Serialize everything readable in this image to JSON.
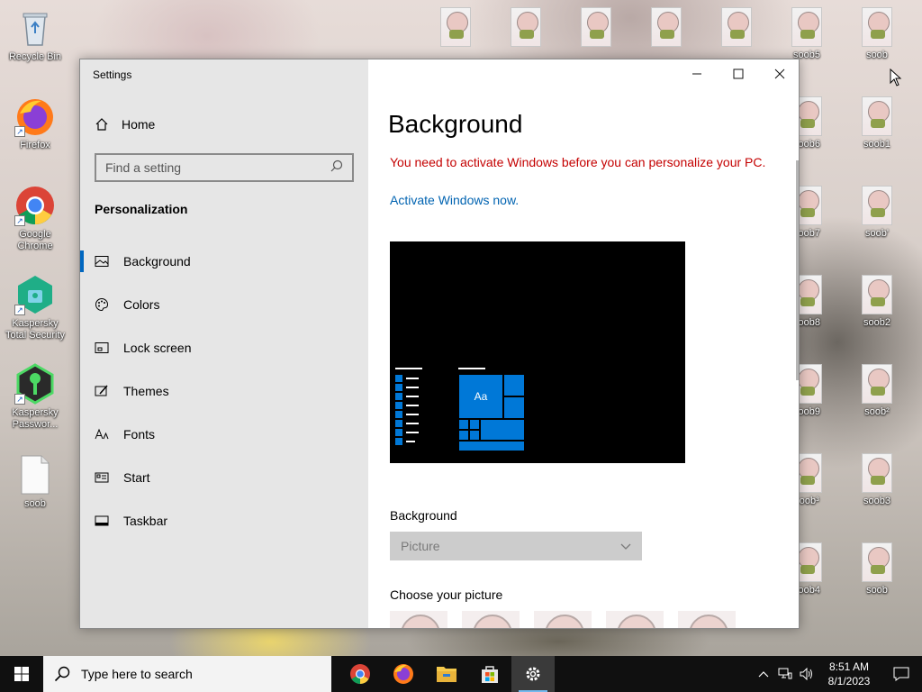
{
  "desktop": {
    "left_icons": [
      {
        "label": "Recycle Bin",
        "icon": "recycle-bin-icon"
      },
      {
        "label": "Firefox",
        "icon": "firefox-icon"
      },
      {
        "label": "Google Chrome",
        "icon": "chrome-icon"
      },
      {
        "label": "Kaspersky Total Security",
        "icon": "kaspersky-total-security-icon"
      },
      {
        "label": "Kaspersky Passwor...",
        "icon": "kaspersky-password-icon"
      },
      {
        "label": "soob",
        "icon": "blank-file-icon"
      }
    ],
    "top_icons": [
      "",
      "",
      "",
      "",
      "",
      "soob5",
      "soob"
    ],
    "right_col1": [
      "soob6",
      "soob7",
      "soob8",
      "soob9",
      "soob³",
      "soob4"
    ],
    "right_col2": [
      "soob1",
      "soob'",
      "soob2",
      "soob²",
      "soob3",
      "soob"
    ]
  },
  "window": {
    "title": "Settings",
    "controls": {
      "minimize": "—",
      "maximize": "☐",
      "close": "✕"
    },
    "sidebar": {
      "home_label": "Home",
      "search_placeholder": "Find a setting",
      "section_heading": "Personalization",
      "items": [
        {
          "label": "Background",
          "icon": "picture-icon",
          "active": true
        },
        {
          "label": "Colors",
          "icon": "palette-icon"
        },
        {
          "label": "Lock screen",
          "icon": "lock-screen-icon"
        },
        {
          "label": "Themes",
          "icon": "themes-brush-icon"
        },
        {
          "label": "Fonts",
          "icon": "fonts-icon"
        },
        {
          "label": "Start",
          "icon": "start-icon"
        },
        {
          "label": "Taskbar",
          "icon": "taskbar-icon"
        }
      ]
    },
    "content": {
      "title": "Background",
      "warning": "You need to activate Windows before you can personalize your PC.",
      "activate_link": "Activate Windows now.",
      "preview_tile_text": "Aa",
      "background_label": "Background",
      "background_select_value": "Picture",
      "choose_picture_label": "Choose your picture"
    }
  },
  "taskbar": {
    "search_placeholder": "Type here to search",
    "apps": [
      "chrome-icon",
      "firefox-icon",
      "file-explorer-icon",
      "microsoft-store-icon",
      "settings-gear-icon"
    ],
    "time": "8:51 AM",
    "date": "8/1/2023"
  },
  "colors": {
    "accent": "#0078d7",
    "warning": "#c40000",
    "link": "#0063b1",
    "taskbar": "#101010"
  }
}
